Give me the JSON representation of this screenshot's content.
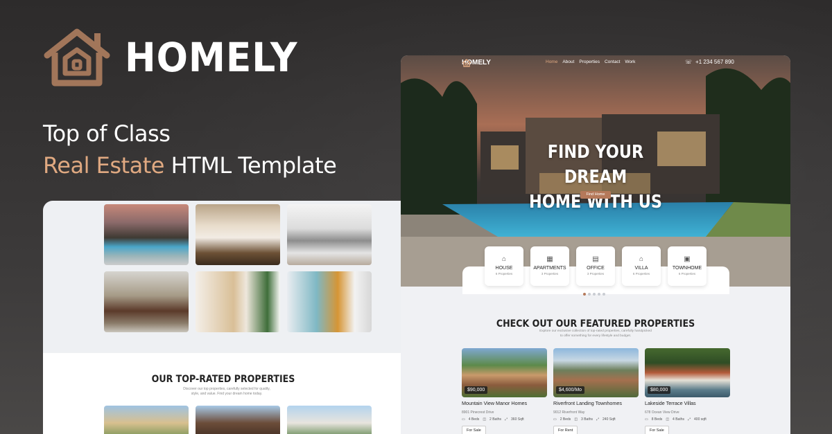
{
  "brand": {
    "name": "HOMELY",
    "accent_color": "#a2765a"
  },
  "tagline": {
    "line1": "Top of Class",
    "line2_accent": "Real Estate",
    "line2_rest": "HTML Template"
  },
  "nav": {
    "logo": "HOMELY",
    "links": [
      "Home",
      "About",
      "Properties",
      "Contact",
      "Work"
    ],
    "phone": "+1 234 567 890"
  },
  "hero": {
    "title_line1": "FIND YOUR DREAM",
    "title_line2": "HOME WITH US",
    "button": "Find Home"
  },
  "categories": [
    {
      "name": "HOUSE",
      "count": "6 Properties",
      "icon": "house-icon"
    },
    {
      "name": "APARTMENTS",
      "count": "3 Properties",
      "icon": "building-icon"
    },
    {
      "name": "OFFICE",
      "count": "3 Properties",
      "icon": "office-icon"
    },
    {
      "name": "VILLA",
      "count": "6 Properties",
      "icon": "villa-icon"
    },
    {
      "name": "TOWNHOME",
      "count": "6 Properties",
      "icon": "townhome-icon"
    }
  ],
  "featured": {
    "title": "CHECK OUT OUR FEATURED PROPERTIES",
    "subtitle": "Explore our exclusive collection of top-rated properties, carefully handpicked to offer something for every lifestyle and budget.",
    "cards": [
      {
        "price": "$90,000",
        "title": "Mountain View Manor Homes",
        "address": "8901 Pinecrest Drive",
        "beds": "4 Beds",
        "baths": "2 Baths",
        "area": "360 Sqft",
        "button": "For Sale"
      },
      {
        "price": "$4,600/Mo",
        "title": "Riverfront Landing Townhomes",
        "address": "9012 Riverfront Way",
        "beds": "2 Beds",
        "baths": "3 Baths",
        "area": "240 Sqft",
        "button": "For Rent"
      },
      {
        "price": "$80,000",
        "title": "Lakeside Terrace Villas",
        "address": "678 Ocean View Drive",
        "beds": "8 Beds",
        "baths": "4 Baths",
        "area": "400 sqft",
        "button": "For Sale"
      }
    ]
  },
  "rated": {
    "title": "OUR TOP-RATED PROPERTIES",
    "subtitle": "Discover our top properties, carefully selected for quality, style, and value. Find your dream home today."
  }
}
